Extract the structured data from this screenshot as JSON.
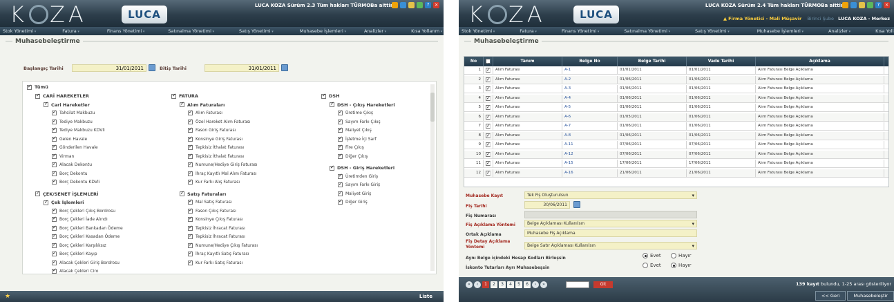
{
  "left": {
    "logo": "KOZA",
    "luca": "LUCA",
    "top_text": "LUCA KOZA Sürüm 2.3 Tüm hakları TÜRMOBa aittir.",
    "menu": [
      "Stok Yönetimi",
      "Fatura",
      "Finans Yönetimi",
      "Satınalma Yönetimi",
      "Satış Yönetimi",
      "Muhasebe İşlemleri",
      "Analizler",
      "Kısa Yollarım"
    ],
    "section_title": "Muhasebeleştirme",
    "start_label": "Başlangıç Tarihi",
    "start_date": "31/01/2011",
    "end_label": "Bitiş Tarihi",
    "end_date": "31/01/2011",
    "tree": {
      "all": "Tümü",
      "col1": [
        {
          "t": "CARİ HAREKETLER",
          "lvl": 1
        },
        {
          "t": "Cari Hareketler",
          "lvl": 2
        },
        {
          "t": "Tahsilat Makbuzu",
          "lvl": 3
        },
        {
          "t": "Tediye Makbuzu",
          "lvl": 3
        },
        {
          "t": "Tediye Makbuzu KDVli",
          "lvl": 3
        },
        {
          "t": "Gelen Havale",
          "lvl": 3
        },
        {
          "t": "Gönderilen Havale",
          "lvl": 3
        },
        {
          "t": "Virman",
          "lvl": 3
        },
        {
          "t": "Alacak Dekontu",
          "lvl": 3
        },
        {
          "t": "Borç Dekontu",
          "lvl": 3
        },
        {
          "t": "Borç Dekontu KDVli",
          "lvl": 3
        },
        {
          "t": "ÇEK/SENET İŞLEMLERİ",
          "lvl": 1
        },
        {
          "t": "Çek İşlemleri",
          "lvl": 2
        },
        {
          "t": "Borç Çekleri Çıkış Bordrosu",
          "lvl": 3
        },
        {
          "t": "Borç Çekleri İade Alındı",
          "lvl": 3
        },
        {
          "t": "Borç Çekleri Bankadan Ödeme",
          "lvl": 3
        },
        {
          "t": "Borç Çekleri Kasadan Ödeme",
          "lvl": 3
        },
        {
          "t": "Borç Çekleri Karşılıksız",
          "lvl": 3
        },
        {
          "t": "Borç Çekleri Kayıp",
          "lvl": 3
        },
        {
          "t": "Alacak Çekleri Giriş Bordrosu",
          "lvl": 3
        },
        {
          "t": "Alacak Çekleri Ciro",
          "lvl": 3
        }
      ],
      "col2": [
        {
          "t": "FATURA",
          "lvl": 1
        },
        {
          "t": "Alım Faturaları",
          "lvl": 2
        },
        {
          "t": "Alım Faturası",
          "lvl": 3
        },
        {
          "t": "Özel Hareket Alım Faturası",
          "lvl": 3
        },
        {
          "t": "Fason Giriş Faturası",
          "lvl": 3
        },
        {
          "t": "Konsinye Giriş Faturası",
          "lvl": 3
        },
        {
          "t": "Tepkisiz İthalat Faturası",
          "lvl": 3
        },
        {
          "t": "Tepkisiz İthalat Faturası",
          "lvl": 3
        },
        {
          "t": "Numune/Hediye Giriş Faturası",
          "lvl": 3
        },
        {
          "t": "İhraç Kayıtlı Mal Alım Faturası",
          "lvl": 3
        },
        {
          "t": "Kur Farkı Alış Faturası",
          "lvl": 3
        },
        {
          "t": "Satış Faturaları",
          "lvl": 2
        },
        {
          "t": "Mal Satış Faturası",
          "lvl": 3
        },
        {
          "t": "Fason Çıkış Faturası",
          "lvl": 3
        },
        {
          "t": "Konsinye Çıkış Faturası",
          "lvl": 3
        },
        {
          "t": "Tepkisiz İhracat Faturası",
          "lvl": 3
        },
        {
          "t": "Tepkisiz İhracat Faturası",
          "lvl": 3
        },
        {
          "t": "Numune/Hediye Çıkış Faturası",
          "lvl": 3
        },
        {
          "t": "İhraç Kayıtlı Satış Faturası",
          "lvl": 3
        },
        {
          "t": "Kur Farkı Satış Faturası",
          "lvl": 3
        }
      ],
      "col3": [
        {
          "t": "DSH",
          "lvl": 1
        },
        {
          "t": "DSH - Çıkış Hareketleri",
          "lvl": 2
        },
        {
          "t": "Üretime Çıkış",
          "lvl": 3
        },
        {
          "t": "Sayım Farkı Çıkış",
          "lvl": 3
        },
        {
          "t": "Maliyet Çıkış",
          "lvl": 3
        },
        {
          "t": "İşletme İçi Sarf",
          "lvl": 3
        },
        {
          "t": "Fire Çıkış",
          "lvl": 3
        },
        {
          "t": "Diğer Çıkış",
          "lvl": 3
        },
        {
          "t": "DSH - Giriş Hareketleri",
          "lvl": 2
        },
        {
          "t": "Üretimden Giriş",
          "lvl": 3
        },
        {
          "t": "Sayım Farkı Giriş",
          "lvl": 3
        },
        {
          "t": "Maliyet Giriş",
          "lvl": 3
        },
        {
          "t": "Diğer Giriş",
          "lvl": 3
        }
      ]
    },
    "footer_button": "Liste"
  },
  "right": {
    "logo": "KOZA",
    "luca": "LUCA",
    "top_text": "LUCA KOZA Sürüm 2.4 Tüm hakları TÜRMOBa aittir.",
    "user_role": "Firma Yönetici - Mali Müşavir",
    "user_branch": "Birinci Şube",
    "user_company": "LUCA KOZA - Merkez",
    "menu": [
      "Stok Yönetimi",
      "Fatura",
      "Finans Yönetimi",
      "Satınalma Yönetimi",
      "Satış Yönetimi",
      "Muhasebe İşlemleri",
      "Analizler",
      "Kısa Yollarım"
    ],
    "section_title": "Muhasebeleştirme",
    "columns": [
      "No",
      "",
      "Tanım",
      "Belge No",
      "Belge Tarihi",
      "Vade Tarihi",
      "Açıklama"
    ],
    "rows": [
      [
        "1",
        "Alım Faturası",
        "A-1",
        "01/01/2011",
        "01/01/2011",
        "Alım Faturası Belge Açıklama"
      ],
      [
        "2",
        "Alım Faturası",
        "A-2",
        "01/06/2011",
        "01/06/2011",
        "Alım Faturası Belge Açıklama"
      ],
      [
        "3",
        "Alım Faturası",
        "A-3",
        "01/06/2011",
        "01/06/2011",
        "Alım Faturası Belge Açıklama"
      ],
      [
        "4",
        "Alım Faturası",
        "A-4",
        "01/06/2011",
        "01/06/2011",
        "Alım Faturası Belge Açıklama"
      ],
      [
        "5",
        "Alım Faturası",
        "A-5",
        "01/06/2011",
        "01/06/2011",
        "Alım Faturası Belge Açıklama"
      ],
      [
        "6",
        "Alım Faturası",
        "A-6",
        "01/05/2011",
        "01/06/2011",
        "Alım Faturası Belge Açıklama"
      ],
      [
        "7",
        "Alım Faturası",
        "A-7",
        "01/06/2011",
        "01/06/2011",
        "Alım Faturası Belge Açıklama"
      ],
      [
        "8",
        "Alım Faturası",
        "A-8",
        "01/06/2011",
        "01/06/2011",
        "Alım Faturası Belge Açıklama"
      ],
      [
        "9",
        "Alım Faturası",
        "A-11",
        "07/06/2011",
        "07/06/2011",
        "Alım Faturası Belge Açıklama"
      ],
      [
        "10",
        "Alım Faturası",
        "A-12",
        "07/06/2011",
        "07/06/2011",
        "Alım Faturası Belge Açıklama"
      ],
      [
        "11",
        "Alım Faturası",
        "A-15",
        "17/06/2011",
        "17/06/2011",
        "Alım Faturası Belge Açıklama"
      ],
      [
        "12",
        "Alım Faturası",
        "A-16",
        "21/06/2011",
        "21/06/2011",
        "Alım Faturası Belge Açıklama"
      ]
    ],
    "form": {
      "kayit_label": "Muhasebe Kayıt",
      "kayit_value": "Tek Fiş Oluşturulsun",
      "fis_tarihi_label": "Fiş Tarihi",
      "fis_tarihi_value": "30/06/2011",
      "fis_no_label": "Fiş Numarası",
      "fis_no_value": "",
      "fis_aciklama_yontemi_label": "Fiş Açıklama Yöntemi",
      "fis_aciklama_yontemi_value": "Belge Açıklaması Kullanılsın",
      "ortak_aciklama_label": "Ortak Açıklama",
      "ortak_aciklama_value": "Muhasebe Fiş Açıklama",
      "detay_label_1": "Fiş Detay Açıklama",
      "detay_label_2": "Yöntemi",
      "detay_value": "Belge Satır Açıklaması Kullanılsın",
      "q1": "Aynı Belge içindeki Hesap Kodları Birleşsin",
      "q2": "İskonto Tutarları Ayrı Muhasebeşsin",
      "evet": "Evet",
      "hayir": "Hayır"
    },
    "pager": {
      "pages": [
        "1",
        "2",
        "3",
        "4",
        "5",
        "6"
      ],
      "goto_button": "Git",
      "found_bold": "139 kayıt",
      "found_rest": "bulundu, 1-25 arası gösteriliyor",
      "back_button": "<< Geri",
      "next_button": "Muhasebeleştir"
    }
  }
}
